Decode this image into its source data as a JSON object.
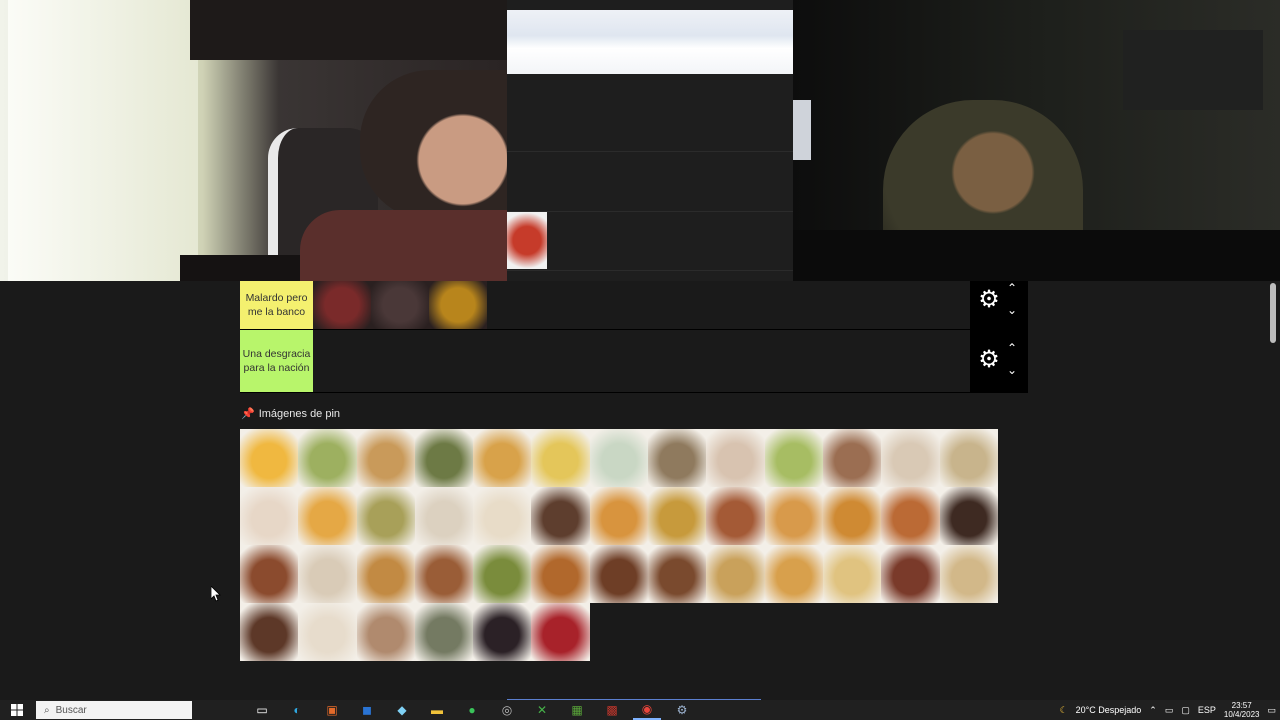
{
  "tiers": [
    {
      "label": "Malardo pero me la banco",
      "color": "#f4f06f",
      "items": [
        {
          "name": "food-item",
          "color": "#7a2a2a"
        },
        {
          "name": "food-item",
          "color": "#4a3838"
        },
        {
          "name": "food-item",
          "color": "#b8851c"
        }
      ]
    },
    {
      "label": "Una desgracia para la nación",
      "color": "#b8f56b",
      "items": []
    }
  ],
  "upper_tier_item_color": "#c63b2a",
  "pin_section": {
    "title": "Imágenes de pin",
    "tiles": [
      "#f0b840",
      "#9db060",
      "#c99a5a",
      "#6d7a45",
      "#d8a24a",
      "#e4c65a",
      "#c9d7c4",
      "#8f7a5e",
      "#d8c3b0",
      "#a7bd63",
      "#9b6e52",
      "#d9c9b5",
      "#c8b48c",
      "#e7d7c7",
      "#e5a845",
      "#a8a059",
      "#dcd1c0",
      "#e8dcc8",
      "#5e3e2e",
      "#d8943e",
      "#c79a3c",
      "#a45a36",
      "#d89a4b",
      "#cf8a33",
      "#bb6a35",
      "#3e2a22",
      "#8b4b2e",
      "#d9cbb7",
      "#c28a43",
      "#9a5d37",
      "#7a8c3c",
      "#b1682c",
      "#6e3e26",
      "#7a4a2e",
      "#c9a15b",
      "#d8a04c",
      "#e0c380",
      "#7a3a2a",
      "#d2b889",
      "#5d3828",
      "#e7dccc",
      "#b08a6e",
      "#747a62",
      "#2b2126",
      "#a8222a"
    ]
  },
  "taskbar": {
    "search_placeholder": "Buscar",
    "weather": "20°C  Despejado",
    "lang": "ESP",
    "time": "23:57",
    "date": "10/4/2023"
  }
}
